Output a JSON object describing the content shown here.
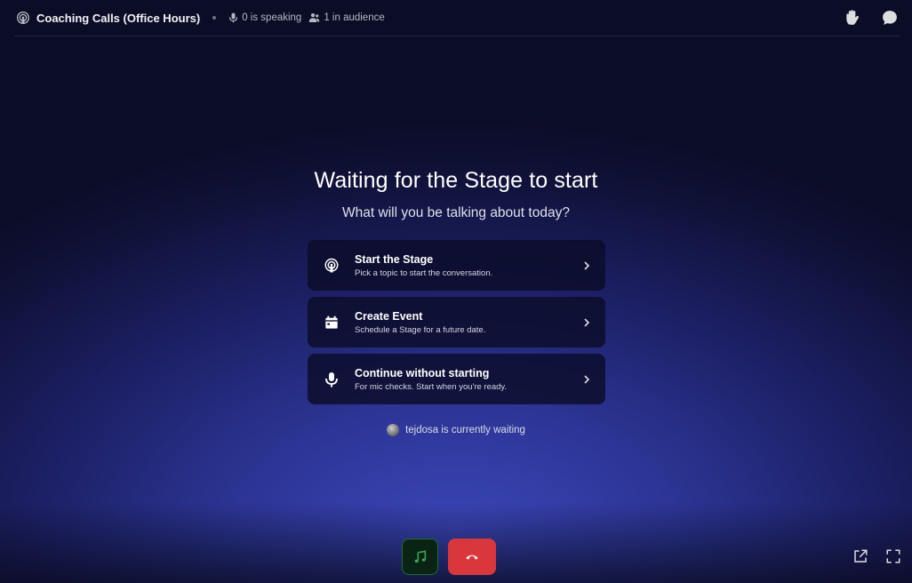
{
  "header": {
    "title": "Coaching Calls (Office Hours)",
    "speaking": "0 is speaking",
    "audience": "1 in audience",
    "stage_icon": "stage-channel-icon",
    "raise_hand_icon": "raise-hand-icon",
    "chat_icon": "chat-icon"
  },
  "main": {
    "heading": "Waiting for the Stage to start",
    "subheading": "What will you be talking about today?",
    "options": [
      {
        "icon": "stage-broadcast-icon",
        "title": "Start the Stage",
        "description": "Pick a topic to start the conversation."
      },
      {
        "icon": "calendar-icon",
        "title": "Create Event",
        "description": "Schedule a Stage for a future date."
      },
      {
        "icon": "microphone-icon",
        "title": "Continue without starting",
        "description": "For mic checks. Start when you're ready."
      }
    ],
    "waiting_text": "tejdosa is currently waiting"
  },
  "controls": {
    "music_icon": "music-note-icon",
    "leave_icon": "phone-hangup-icon",
    "popout_icon": "popout-icon",
    "fullscreen_icon": "fullscreen-icon"
  },
  "colors": {
    "leave": "#da373c",
    "music_bg": "#0a2413",
    "music_accent": "#3ba55c",
    "card_bg": "#0b0c28"
  }
}
